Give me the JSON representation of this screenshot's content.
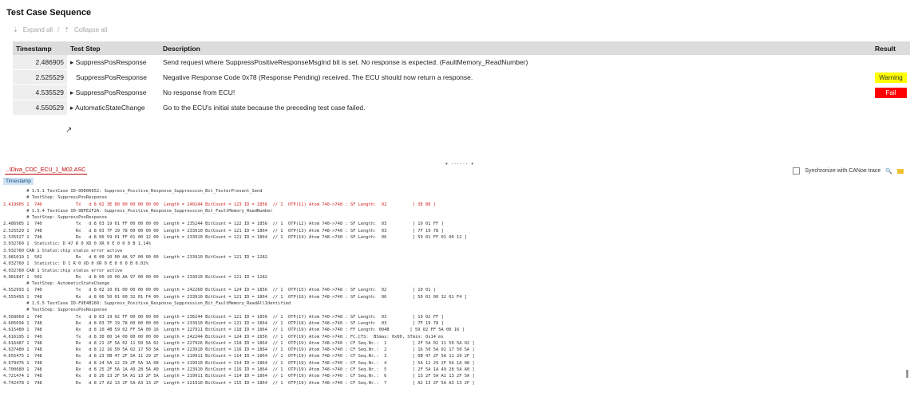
{
  "title": "Test Case Sequence",
  "toolbar": {
    "expand_all": "Expand all",
    "collapse_all": "Collapse all"
  },
  "table": {
    "headers": {
      "timestamp": "Timestamp",
      "step": "Test Step",
      "description": "Description",
      "result": "Result"
    },
    "rows": [
      {
        "ts": "2.486905",
        "step": "SuppressPosResponse",
        "bullet": true,
        "desc": "Send request where SuppressPositiveResponseMsgInd bit is set. No response is expected. (FaultMemory_ReadNumber)",
        "result": ""
      },
      {
        "ts": "2.525529",
        "step": "SuppressPosResponse",
        "bullet": false,
        "desc": "Negative Response Code 0x78 (Response Pending) received. The ECU should now return a response.",
        "result": "Warning"
      },
      {
        "ts": "4.535529",
        "step": "SuppressPosResponse",
        "bullet": true,
        "desc": "No response from ECU!",
        "result": "Fail"
      },
      {
        "ts": "4.550529",
        "step": "AutomaticStateChange",
        "bullet": true,
        "desc": "Go to the ECU's initial state because the preceding test case failed.",
        "result": ""
      }
    ]
  },
  "trace": {
    "tab": "...\\Diva_CDC_ECU_1_M02.ASC",
    "sync_label": "Synchronize with CANoe trace",
    "timestamp_button": "Timestamp",
    "lines": [
      "         # 1.5.1 TestCase ID-90D06652: Suppress_Positive_Response_Suppression_Bit_TesterPresent_Send",
      "         # TestStep: SuppressPosResponse",
      "2.419905 1  740             Tx   d 8 02 3E 80 00 00 00 00 00  Length = 240244 BitCount = 123 ID = 1856  // 1  OTP(11) Atom 740->748 : SF Length:  02          [ 3E 80 ]",
      "         # 1.5.4 TestCase ID-98FE2F2A: Suppress_Positive_Response_Suppression_Bit_FaultMemory_ReadNumber",
      "         # TestStep: SuppressPosResponse",
      "2.486905 1  740             Tx   d 8 03 19 01 FF 00 00 00 00  Length = 235244 BitCount = 122 ID = 1856  // 1  OTP(12) Atom 740->748 : SF Length:  03          [ 19 01 FF ]",
      "2.525529 1  748             Rx   d 8 03 7F 19 78 00 00 00 00  Length = 233910 BitCount = 121 ID = 1864  // 1  OTP(13) Atom 748->740 : SF Length:  03          [ 7F 19 78 ]",
      "2.535527 1  748             Rx   d 8 06 59 01 FF 01 00 12 00  Length = 233910 BitCount = 121 ID = 1864  // 1  OTP(14) Atom 748->740 : SF Length:  06          [ 59 01 FF 01 00 12 ]",
      "3.032760 1  Statistic: D 47 R 0 XD 0 XR 0 E 0 0 0 B 1.14%",
      "3.032760 CAN 1 Status:chip status error active",
      "3.081019 1  502             Rx   d 8 00 10 00 AA 97 00 00 00  Length = 233910 BitCount = 121 ID = 1282",
      "4.032760 1  Statistic: D 1 R 0 XD 0 XR 0 E 0 0 0 B 0.02%",
      "4.032760 CAN 1 Status:chip status error active",
      "4.081847 1  502             Rx   d 8 00 10 00 AA 97 00 00 00  Length = 233910 BitCount = 121 ID = 1282",
      "         # TestStep: AutomaticStateChange",
      "4.552993 1  740             Tx   d 8 02 10 01 00 00 00 00 00  Length = 242260 BitCount = 124 ID = 1856  // 1  OTP(15) Atom 740->748 : SF Length:  02          [ 10 01 ]",
      "4.555493 1  748             Rx   d 8 06 50 01 00 32 01 F4 00  Length = 233910 BitCount = 121 ID = 1864  // 1  OTP(16) Atom 748->740 : SF Length:  06          [ 50 01 00 32 01 F4 ]",
      "         # 1.5.5 TestCase ID-F9E4B160: Suppress_Positive_Response_Suppression_Bit_FaultMemory_ReadAllIdentified",
      "         # TestStep: SuppressPosResponse",
      "4.568069 1  740             Tx   d 8 03 19 02 FF 00 00 00 00  Length = 236244 BitCount = 121 ID = 1856  // 1  OTP(17) Atom 740->748 : SF Length:  03          [ 19 02 FF ]",
      "4.605694 1  748             Rx   d 8 03 7F 19 78 00 00 00 00  Length = 233910 BitCount = 121 ID = 1864  // 1  OTP(18) Atom 748->740 : SF Length:  03          [ 7F 19 78 ]",
      "4.615480 1  748             Rx   d 8 10 4B 59 02 FF 5A 00 16  Length = 227911 BitCount = 118 ID = 1864  // 1  OTP(19) Atom 748->740 : FF Length: 004B        [ 59 02 FF 5A 00 16 ]",
      "4.616195 1  740             Tx   d 8 30 00 14 00 00 00 00 00  Length = 242244 BitCount = 124 ID = 1856  // 1  OTP(19) Atom 740->748 : FC.CTS:  BSmax: 0x00, STmin: 0x14 ms",
      "4.616487 1  748             Rx   d 8 21 2F 5A 02 11 50 5A 02  Length = 227926 BitCount = 118 ID = 1864  // 1  OTP(19) Atom 748->740 : CF Seq.Nr.:  1          [ 2F 5A 02 11 50 5A 02 ]",
      "4.637480 1  748             Rx   d 8 22 16 50 5A 02 17 50 5A  Length = 223910 BitCount = 116 ID = 1864  // 1  OTP(19) Atom 748->740 : CF Seq.Nr.:  2          [ 16 50 5A 02 17 50 5A ]",
      "4.655475 1  748             Rx   d 8 23 0B 47 2F 5A 11 29 2F  Length = 219911 BitCount = 114 ID = 1864  // 1  OTP(19) Atom 748->740 : CF Seq.Nr.:  3          [ 0B 47 2F 5A 11 29 2F ]",
      "4.679476 1  748             Rx   d 8 24 5A 12 29 2F 5A 1A 08  Length = 219910 BitCount = 114 ID = 1864  // 1  OTP(19) Atom 748->740 : CF Seq.Nr.:  4          [ 5A 12 29 2F 5A 1A 08 ]",
      "4.700680 1  748             Rx   d 8 25 2F 5A 1A 49 28 5A A0  Length = 223910 BitCount = 116 ID = 1864  // 1  OTP(19) Atom 748->740 : CF Seq.Nr.:  5          [ 2F 5A 1A 49 28 5A A0 ]",
      "4.721474 1  748             Rx   d 8 26 13 2F 5A A1 13 2F 5A  Length = 219911 BitCount = 114 ID = 1864  // 1  OTP(19) Atom 748->740 : CF Seq.Nr.:  6          [ 13 2F 5A A1 13 2F 5A ]",
      "4.742478 1  748             Rx   d 8 27 A2 13 2F 5A A3 13 2F  Length = 221910 BitCount = 115 ID = 1864  // 1  OTP(19) Atom 748->740 : CF Seq.Nr.:  7          [ A2 13 2F 5A A3 13 2F ]"
    ]
  },
  "colors": {
    "warning": "#ffff00",
    "fail": "#ff0000",
    "highlight_line": "#d02020"
  }
}
